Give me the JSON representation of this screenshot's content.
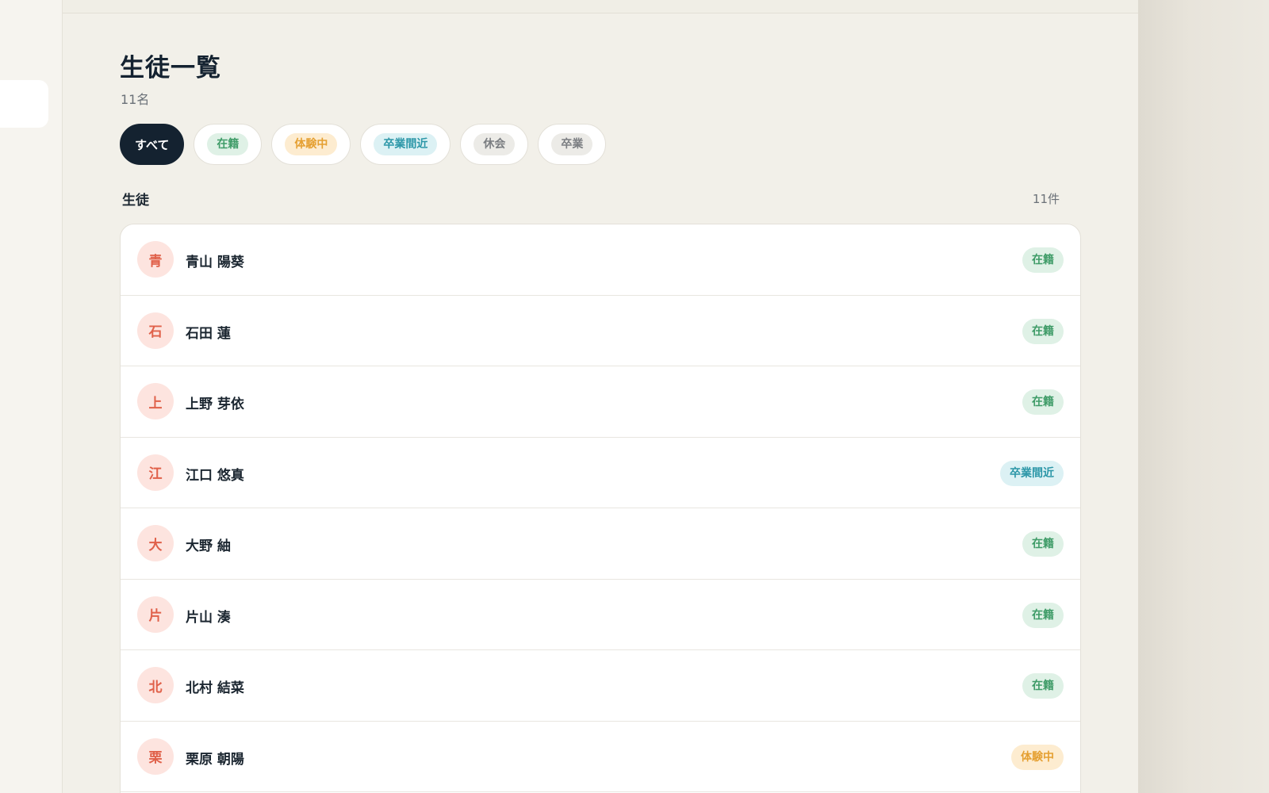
{
  "page": {
    "title": "生徒一覧",
    "count": "11名"
  },
  "filters": [
    {
      "label": "すべて",
      "active": true
    },
    {
      "label": "在籍",
      "kind": "enrolled"
    },
    {
      "label": "体験中",
      "kind": "trial"
    },
    {
      "label": "卒業間近",
      "kind": "soon"
    },
    {
      "label": "休会",
      "kind": "rest"
    },
    {
      "label": "卒業",
      "kind": "grad"
    }
  ],
  "section": {
    "label": "生徒",
    "count": "11件"
  },
  "students": [
    {
      "initial": "青",
      "name": "青山 陽葵",
      "status": "在籍",
      "kind": "enrolled"
    },
    {
      "initial": "石",
      "name": "石田 蓮",
      "status": "在籍",
      "kind": "enrolled"
    },
    {
      "initial": "上",
      "name": "上野 芽依",
      "status": "在籍",
      "kind": "enrolled"
    },
    {
      "initial": "江",
      "name": "江口 悠真",
      "status": "卒業間近",
      "kind": "soon"
    },
    {
      "initial": "大",
      "name": "大野 紬",
      "status": "在籍",
      "kind": "enrolled"
    },
    {
      "initial": "片",
      "name": "片山 湊",
      "status": "在籍",
      "kind": "enrolled"
    },
    {
      "initial": "北",
      "name": "北村 結菜",
      "status": "在籍",
      "kind": "enrolled"
    },
    {
      "initial": "栗",
      "name": "栗原 朝陽",
      "status": "体験中",
      "kind": "trial"
    }
  ],
  "colors": {
    "enrolled": "#3f9c68",
    "trial": "#e5a032",
    "soon": "#2c97a8",
    "rest": "#7b7e82",
    "avatar": "#e0614a",
    "primary": "#142230"
  }
}
